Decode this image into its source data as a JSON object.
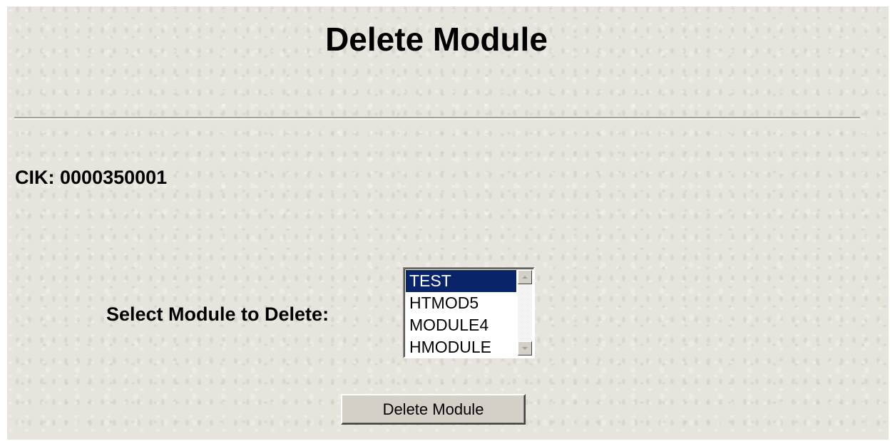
{
  "page": {
    "title": "Delete Module"
  },
  "cik": {
    "label": "CIK:",
    "value": "0000350001"
  },
  "module_select": {
    "label": "Select Module to Delete:",
    "options": [
      "TEST",
      "HTMOD5",
      "MODULE4",
      "HMODULE"
    ],
    "selected": "TEST"
  },
  "actions": {
    "delete_label": "Delete Module"
  },
  "colors": {
    "background": "#e6e4dc",
    "selection": "#0a246a",
    "button_face": "#d4d0c8"
  },
  "icons": {
    "scroll_up": "triangle-up-icon",
    "scroll_down": "triangle-down-icon"
  }
}
